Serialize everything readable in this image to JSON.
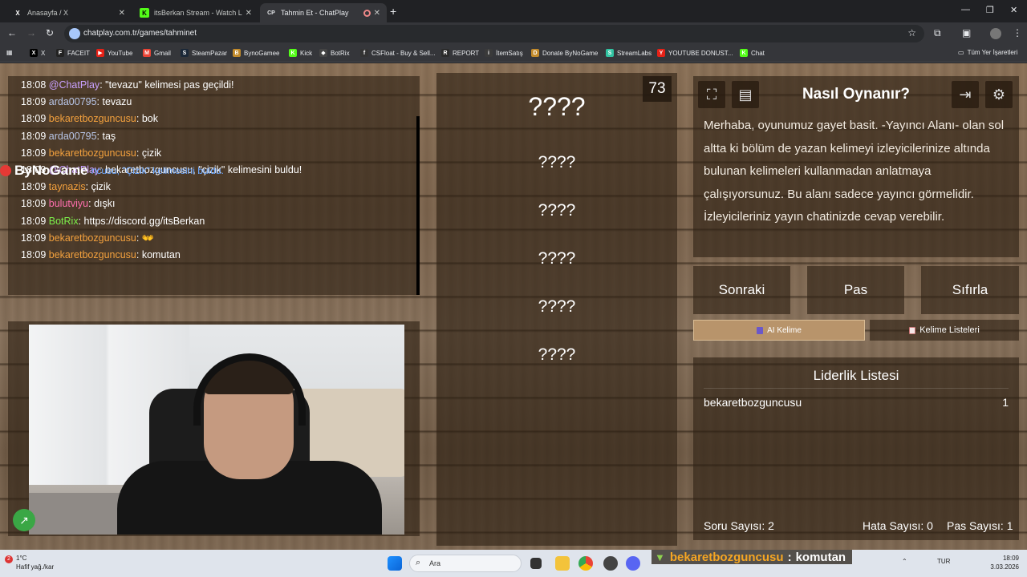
{
  "browser": {
    "tabs": [
      {
        "label": "Anasayfa / X",
        "favicon": "X"
      },
      {
        "label": "itsBerkan Stream - Watch Live o",
        "favicon": "K"
      },
      {
        "label": "Tahmin Et - ChatPlay",
        "favicon": "CP"
      }
    ],
    "url": "chatplay.com.tr/games/tahminet",
    "bookmarks": [
      {
        "label": "X",
        "color": "#000000",
        "glyph": "X"
      },
      {
        "label": "FACEIT",
        "color": "#222222",
        "glyph": "F"
      },
      {
        "label": "YouTube",
        "color": "#e62117",
        "glyph": "▶"
      },
      {
        "label": "Gmail",
        "color": "#ea4335",
        "glyph": "M"
      },
      {
        "label": "SteamPazar",
        "color": "#1b2838",
        "glyph": "S"
      },
      {
        "label": "BynoGamee",
        "color": "#c28a2b",
        "glyph": "B"
      },
      {
        "label": "Kick",
        "color": "#53fc18",
        "glyph": "K"
      },
      {
        "label": "BotRix",
        "color": "#444444",
        "glyph": "◆"
      },
      {
        "label": "CSFloat - Buy & Sell...",
        "color": "#333333",
        "glyph": "f"
      },
      {
        "label": "REPORT",
        "color": "#2b2b2b",
        "glyph": "R"
      },
      {
        "label": "İtemSatış",
        "color": "#3a3a3a",
        "glyph": "i"
      },
      {
        "label": "Donate ByNoGame",
        "color": "#c28a2b",
        "glyph": "D"
      },
      {
        "label": "StreamLabs",
        "color": "#31c3a2",
        "glyph": "S"
      },
      {
        "label": "YOUTUBE DONUST...",
        "color": "#e62117",
        "glyph": "Y"
      },
      {
        "label": "Chat",
        "color": "#53fc18",
        "glyph": "K"
      }
    ],
    "all_bookmarks": "Tüm Yer İşaretleri"
  },
  "chat": {
    "messages": [
      {
        "time": "18:08",
        "user": "@ChatPlay",
        "color": "#c9a0ff",
        "text": "\"tevazu\" kelimesi pas geçildi!"
      },
      {
        "time": "18:09",
        "user": "arda00795",
        "color": "#b8c6e8",
        "text": "tevazu"
      },
      {
        "time": "18:09",
        "user": "bekaretbozguncusu",
        "color": "#f2a03d",
        "text": "bok"
      },
      {
        "time": "18:09",
        "user": "arda00795",
        "color": "#b8c6e8",
        "text": "taş"
      },
      {
        "time": "18:09",
        "user": "bekaretbozguncusu",
        "color": "#f2a03d",
        "text": "çizik"
      },
      {
        "time": "18:09",
        "user": "@ChatPlay",
        "color": "#c9a0ff",
        "text": "bekaretbozguncusu, \"çizik\" kelimesini buldu!"
      },
      {
        "time": "18:09",
        "user": "taynazis",
        "color": "#f2a03d",
        "text": "çizik"
      },
      {
        "time": "18:09",
        "user": "bulutviyu",
        "color": "#ff6fae",
        "text": "dışkı"
      },
      {
        "time": "18:09",
        "user": "BotRix",
        "color": "#7cf04b",
        "text": "https://discord.gg/itsBerkan"
      },
      {
        "time": "18:09",
        "user": "bekaretbozguncusu",
        "color": "#f2a03d",
        "text": "👐"
      },
      {
        "time": "18:09",
        "user": "bekaretbozguncusu",
        "color": "#f2a03d",
        "text": "komutan"
      }
    ],
    "overlay_watermark": "ByNoGame",
    "overlay_faded": "ncusu, \"Çizik\" kelimesini buldu."
  },
  "game": {
    "timer": "73",
    "words": [
      "????",
      "????",
      "????",
      "????",
      "????",
      "????"
    ],
    "howto_title": "Nasıl Oynanır?",
    "howto_text": "Merhaba, oyunumuz gayet basit. -Yayıncı Alanı- olan sol altta ki bölüm de yazan kelimeyi izleyicilerinize altında bulunan kelimeleri kullanmadan anlatmaya çalışıyorsunuz. Bu alanı sadece yayıncı görmelidir. İzleyicileriniz yayın chatinizde cevap verebilir.",
    "buttons": {
      "next": "Sonraki",
      "pass": "Pas",
      "reset": "Sıfırla"
    },
    "ai_words": "AI Kelime",
    "word_lists": "Kelime Listeleri",
    "leaderboard_title": "Liderlik Listesi",
    "leaderboard": [
      {
        "name": "bekaretbozguncusu",
        "score": "1"
      }
    ],
    "stats": {
      "questions": "Soru Sayısı: 2",
      "errors": "Hata Sayısı: 0",
      "passes": "Pas Sayısı: 1"
    }
  },
  "taskbar": {
    "weather_temp": "1°C",
    "weather_desc": "Hafif yağ./kar",
    "weather_badge": "2",
    "search_placeholder": "Ara",
    "lang": "TUR",
    "time": "18:09",
    "date": "3.03.2026",
    "overlay_user": "bekaretbozguncusu",
    "overlay_sep": ":",
    "overlay_msg": "komutan"
  }
}
